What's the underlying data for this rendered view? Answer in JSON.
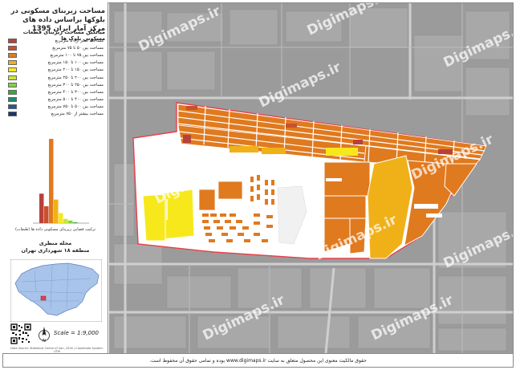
{
  "title": "مساحت زیربنای مسکونی در بلوکها براساس داده های مرکز آمار ایران 1395",
  "legend": {
    "title": "میانگین مساحت زیربنای قطعات مسکونی بلوک ها",
    "items": [
      {
        "label": "مساحت کمتر از ۵۰ مترمربع",
        "color": "#b8423a"
      },
      {
        "label": "مساحت بین ۵۰ تا ۷۵ مترمربع",
        "color": "#c9502e"
      },
      {
        "label": "مساحت بین ۷۵ تا ۱۰۰ مترمربع",
        "color": "#e07a1f"
      },
      {
        "label": "مساحت بین ۱۰۰ تا ۱۵۰ مترمربع",
        "color": "#f0b118"
      },
      {
        "label": "مساحت بین ۱۵۰ تا ۲۰۰ مترمربع",
        "color": "#f7e81c"
      },
      {
        "label": "مساحت بین ۲۰۰ تا ۲۵۰ مترمربع",
        "color": "#c6e636"
      },
      {
        "label": "مساحت بین ۲۵۰ تا ۳۰۰ مترمربع",
        "color": "#7fd43a"
      },
      {
        "label": "مساحت بین ۳۰۰ تا ۴۰۰ مترمربع",
        "color": "#3aa83a"
      },
      {
        "label": "مساحت بین ۴۰۰ تا ۵۰۰ مترمربع",
        "color": "#1d8a6a"
      },
      {
        "label": "مساحت بین ۵۰۰ تا ۷۵۰ مترمربع",
        "color": "#1f5a8c"
      },
      {
        "label": "مساحت بیشتر از ۷۵۰ مترمربع",
        "color": "#1c3470"
      }
    ]
  },
  "histogram": {
    "values": [
      0.35,
      0.2,
      1.0,
      0.28,
      0.12,
      0.05,
      0.03,
      0.01,
      0.0,
      0.0,
      0.0
    ],
    "caption": "ترکیب فضایی زیربنای مسکونی داده ها (طبقات)"
  },
  "region": {
    "line1": "محله منظری",
    "line2": "منطقه ۱۸ شهرداری تهران"
  },
  "scale": "Scale = 1:9,000",
  "north_label": "N",
  "credits": "Data Source: Statistical Centre of Iran, 2016 | Coordinate System: UTM",
  "watermark": "Digimaps.ir",
  "footer": "حقوق مالکیت معنوی این محصول متعلق به سایت www.digimaps.ir بوده و تمامی حقوق آن محفوظ است.",
  "colors": {
    "boundary": "#e8404a",
    "basemap": "#9c9c9c",
    "road": "#d6d6d6"
  }
}
